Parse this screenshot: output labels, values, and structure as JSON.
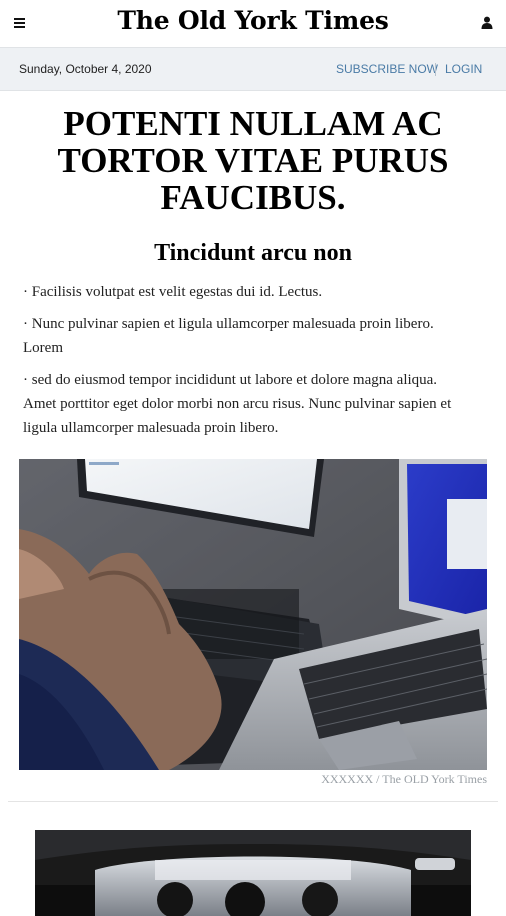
{
  "header": {
    "masthead": "The Old York Times",
    "menu_icon": "hamburger-menu-icon",
    "account_icon": "user-icon"
  },
  "subbar": {
    "date": "Sunday, October 4, 2020",
    "subscribe_label": "SUBSCRIBE NOW",
    "login_label": "LOGIN"
  },
  "article": {
    "headline": "POTENTI NULLAM AC TORTOR VITAE PURUS FAUCIBUS.",
    "subhead": "Tincidunt arcu non",
    "bullets": [
      "· Facilisis volutpat est velit egestas dui id. Lectus.",
      "· Nunc pulvinar sapien et ligula ullamcorper malesuada proin libero. Lorem",
      "· sed do eiusmod tempor incididunt ut labore et dolore magna aliqua. Amet porttitor eget dolor morbi non arcu risus. Nunc pulvinar sapien et ligula ullamcorper malesuada proin libero."
    ],
    "photo_caption": "XXXXXX / The OLD York Times"
  },
  "colors": {
    "subbar_bg": "#eef1f4",
    "link": "#4a7ba6",
    "caption": "#9aa0a6"
  }
}
